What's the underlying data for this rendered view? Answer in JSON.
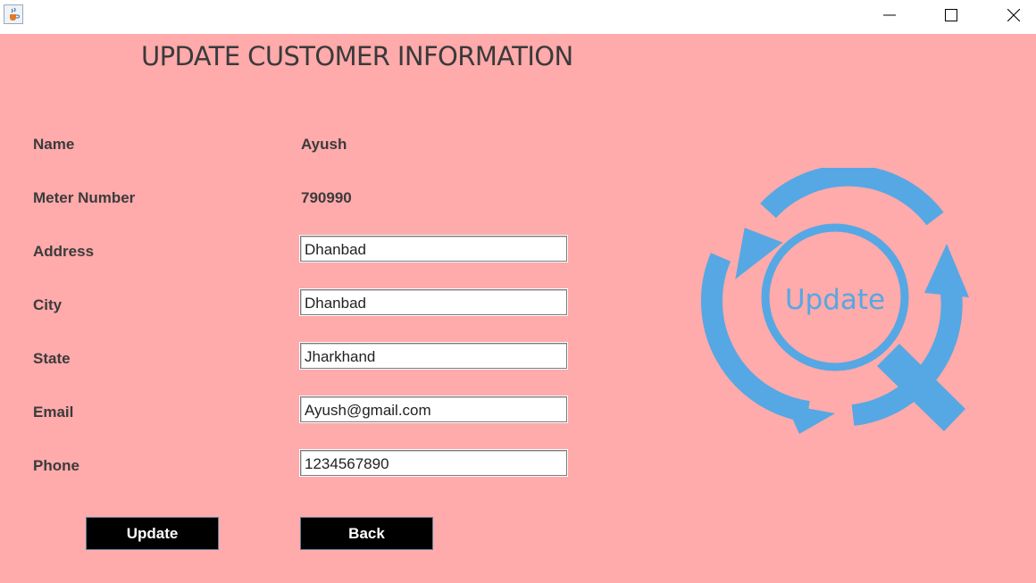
{
  "window": {
    "icon": "java-cup-icon",
    "controls": [
      "minimize-icon",
      "maximize-icon",
      "close-icon"
    ]
  },
  "page": {
    "title": "UPDATE CUSTOMER INFORMATION"
  },
  "form": {
    "name": {
      "label": "Name",
      "value": "Ayush"
    },
    "meter": {
      "label": "Meter Number",
      "value": "790990"
    },
    "address": {
      "label": "Address",
      "value": "Dhanbad"
    },
    "city": {
      "label": "City",
      "value": "Dhanbad"
    },
    "state": {
      "label": "State",
      "value": "Jharkhand"
    },
    "email": {
      "label": "Email",
      "value": "Ayush@gmail.com"
    },
    "phone": {
      "label": "Phone",
      "value": "1234567890"
    }
  },
  "buttons": {
    "update_label": "Update",
    "back_label": "Back"
  },
  "graphic": {
    "text": "Update",
    "color": "#55a8e3"
  },
  "colors": {
    "background": "#ffaaab",
    "button": "#000000"
  }
}
